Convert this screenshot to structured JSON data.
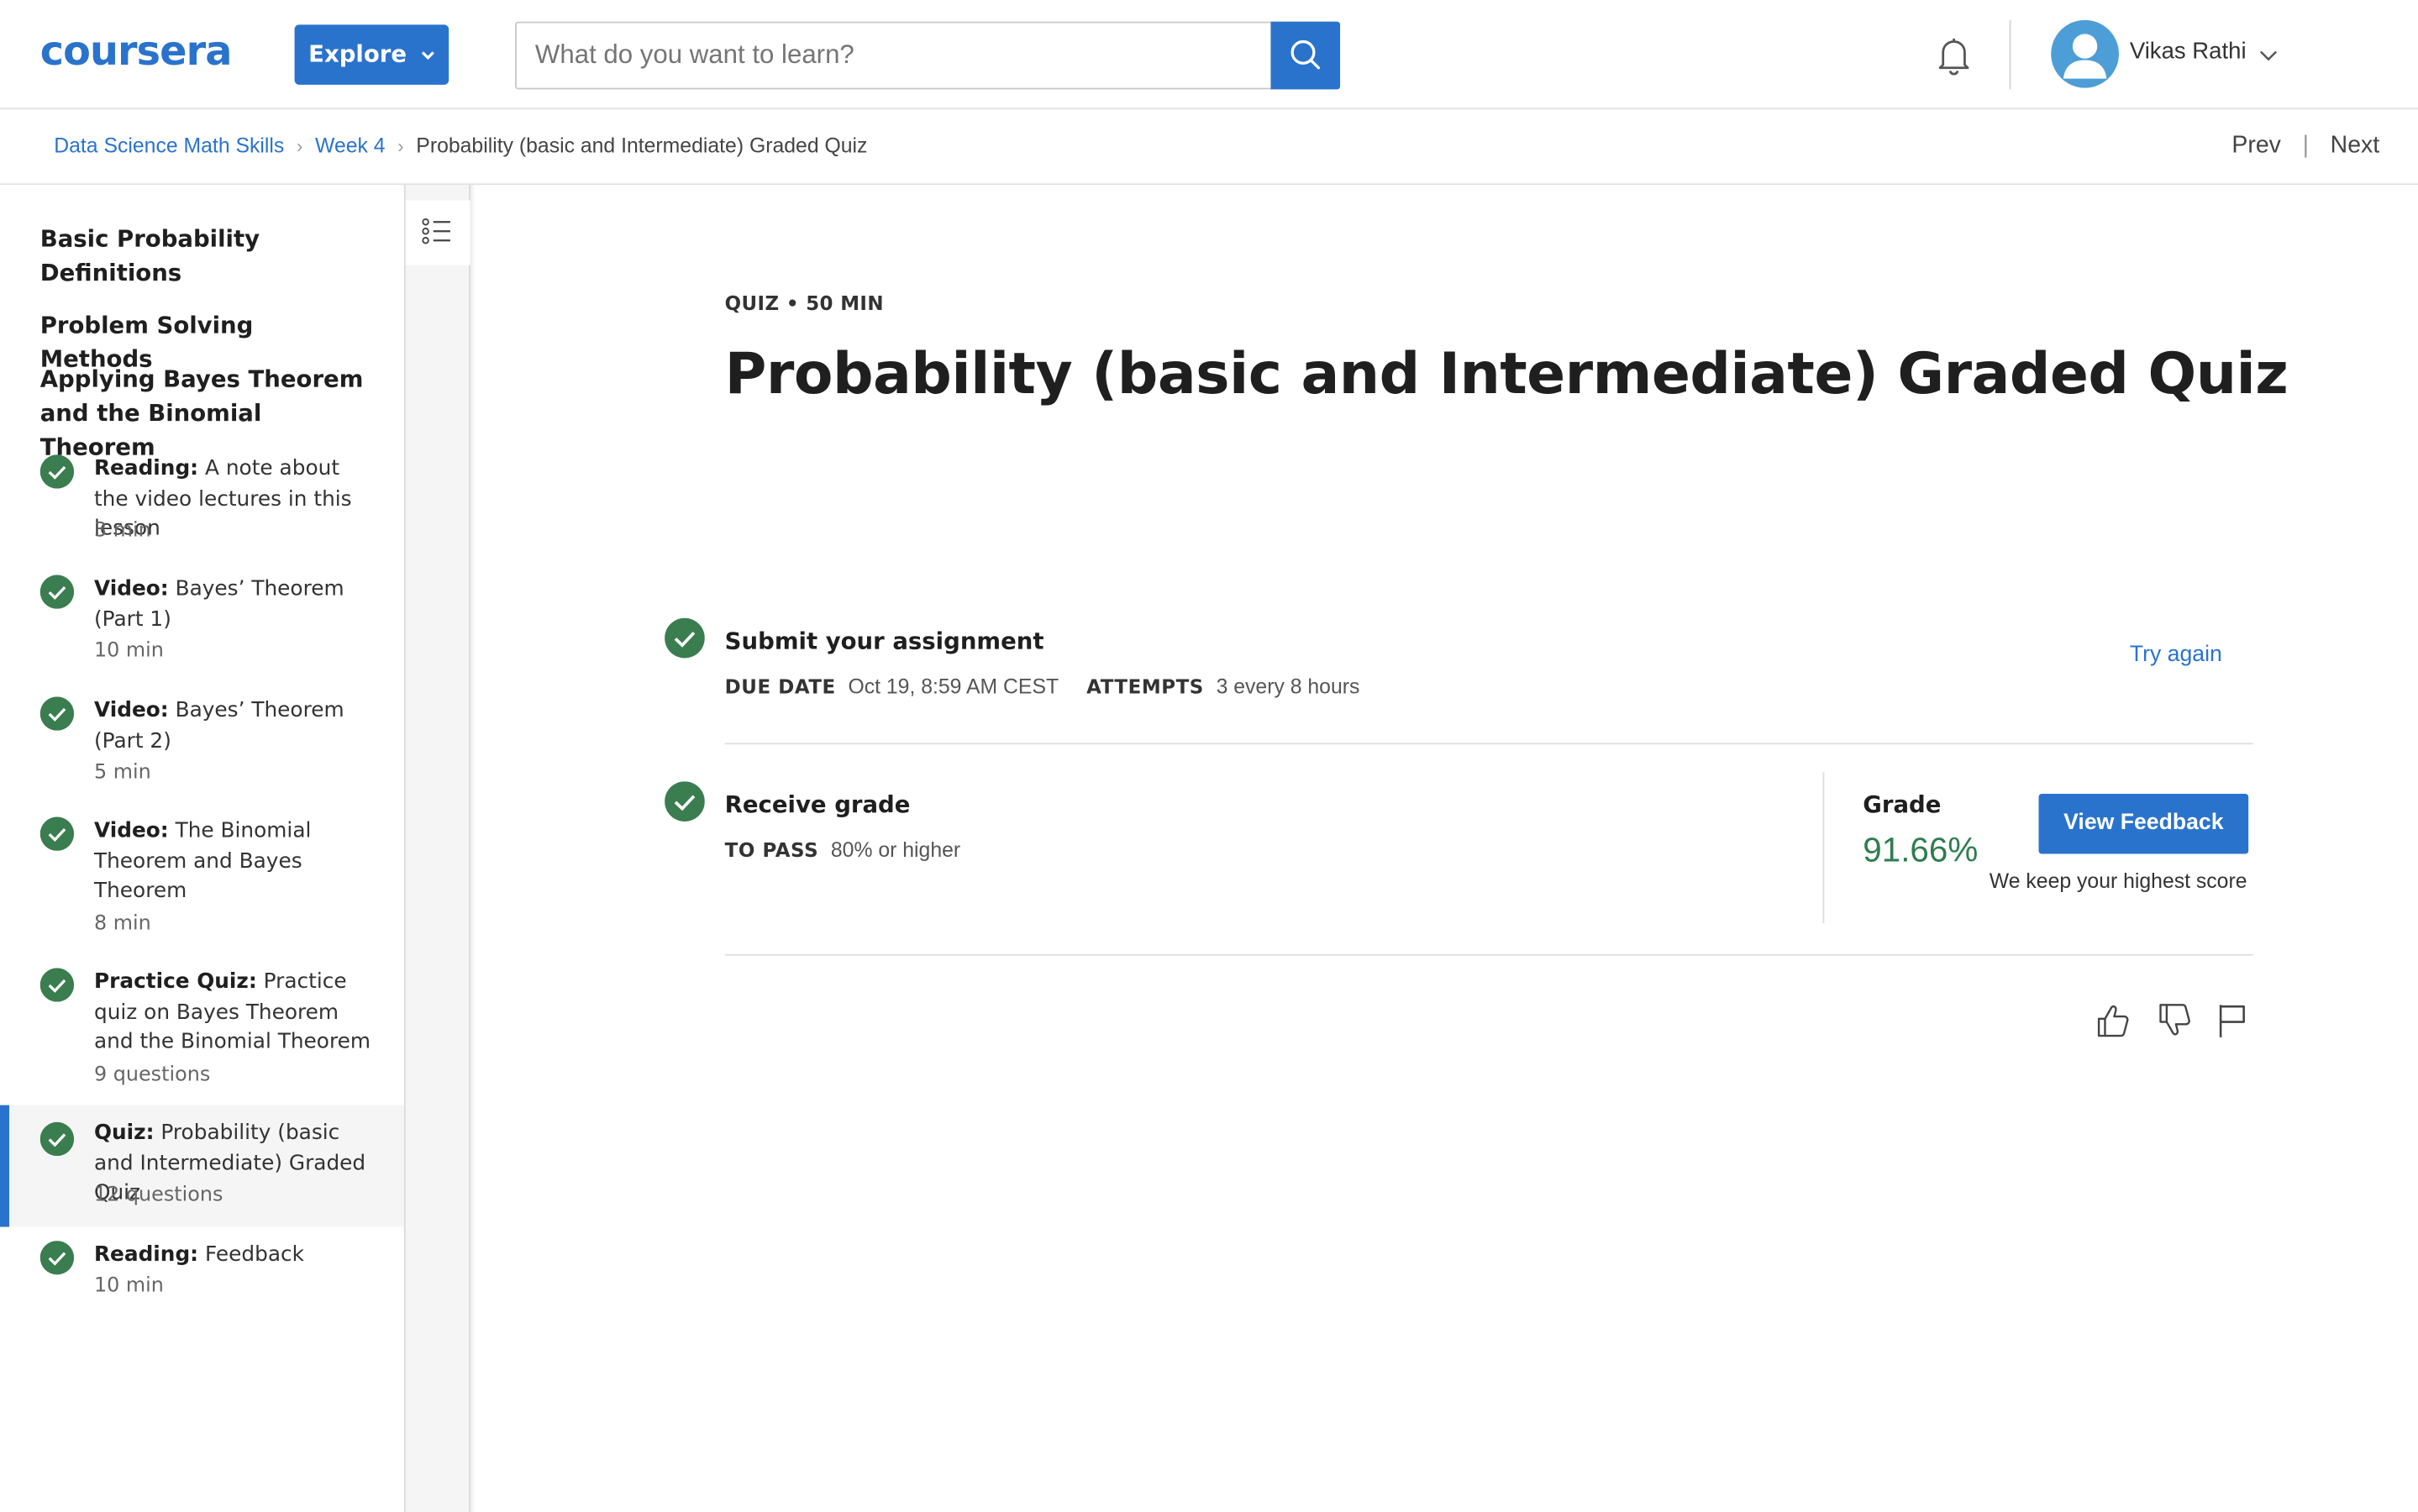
{
  "header": {
    "logo_text": "coursera",
    "explore_label": "Explore",
    "search_placeholder": "What do you want to learn?",
    "user_name": "Vikas Rathi"
  },
  "breadcrumb": {
    "items": [
      "Data Science Math Skills",
      "Week 4"
    ],
    "current": "Probability (basic and Intermediate) Graded Quiz"
  },
  "nav": {
    "prev": "Prev",
    "next": "Next"
  },
  "sidebar": {
    "headings": [
      "Basic Probability Definitions",
      "Problem Solving Methods",
      "Applying Bayes Theorem and the Binomial Theorem"
    ],
    "items": [
      {
        "type": "Reading:",
        "title": "A note about the video lectures in this lesson",
        "meta": "3 min",
        "completed": true,
        "active": false
      },
      {
        "type": "Video:",
        "title": "Bayes’ Theorem (Part 1)",
        "meta": "10 min",
        "completed": true,
        "active": false
      },
      {
        "type": "Video:",
        "title": "Bayes’ Theorem (Part 2)",
        "meta": "5 min",
        "completed": true,
        "active": false
      },
      {
        "type": "Video:",
        "title": "The Binomial Theorem and Bayes Theorem",
        "meta": "8 min",
        "completed": true,
        "active": false
      },
      {
        "type": "Practice Quiz:",
        "title": "Practice quiz on Bayes Theorem and the Binomial Theorem",
        "meta": "9 questions",
        "completed": true,
        "active": false
      },
      {
        "type": "Quiz:",
        "title": "Probability (basic and Intermediate) Graded Quiz",
        "meta": "12 questions",
        "completed": true,
        "active": true
      },
      {
        "type": "Reading:",
        "title": "Feedback",
        "meta": "10 min",
        "completed": true,
        "active": false
      }
    ]
  },
  "main": {
    "eyebrow": "QUIZ • 50 MIN",
    "title": "Probability (basic and Intermediate) Graded Quiz",
    "submit": {
      "title": "Submit your assignment",
      "due_label": "DUE DATE",
      "due_value": "Oct 19, 8:59 AM CEST",
      "attempts_label": "ATTEMPTS",
      "attempts_value": "3 every 8 hours",
      "action": "Try again"
    },
    "receive": {
      "title": "Receive grade",
      "pass_label": "TO PASS",
      "pass_value": "80% or higher",
      "grade_label": "Grade",
      "grade_value": "91.66%",
      "feedback_button": "View Feedback",
      "note": "We keep your highest score"
    }
  },
  "colors": {
    "brand_blue": "#2a73cc",
    "success_green": "#2e7d4f",
    "check_green": "#3a7d4f"
  },
  "icons": [
    "search-icon",
    "bell-icon",
    "user-avatar-icon",
    "chevron-down-icon",
    "chevron-right-icon",
    "list-icon",
    "check-circle-icon",
    "thumbs-up-icon",
    "thumbs-down-icon",
    "flag-icon"
  ]
}
